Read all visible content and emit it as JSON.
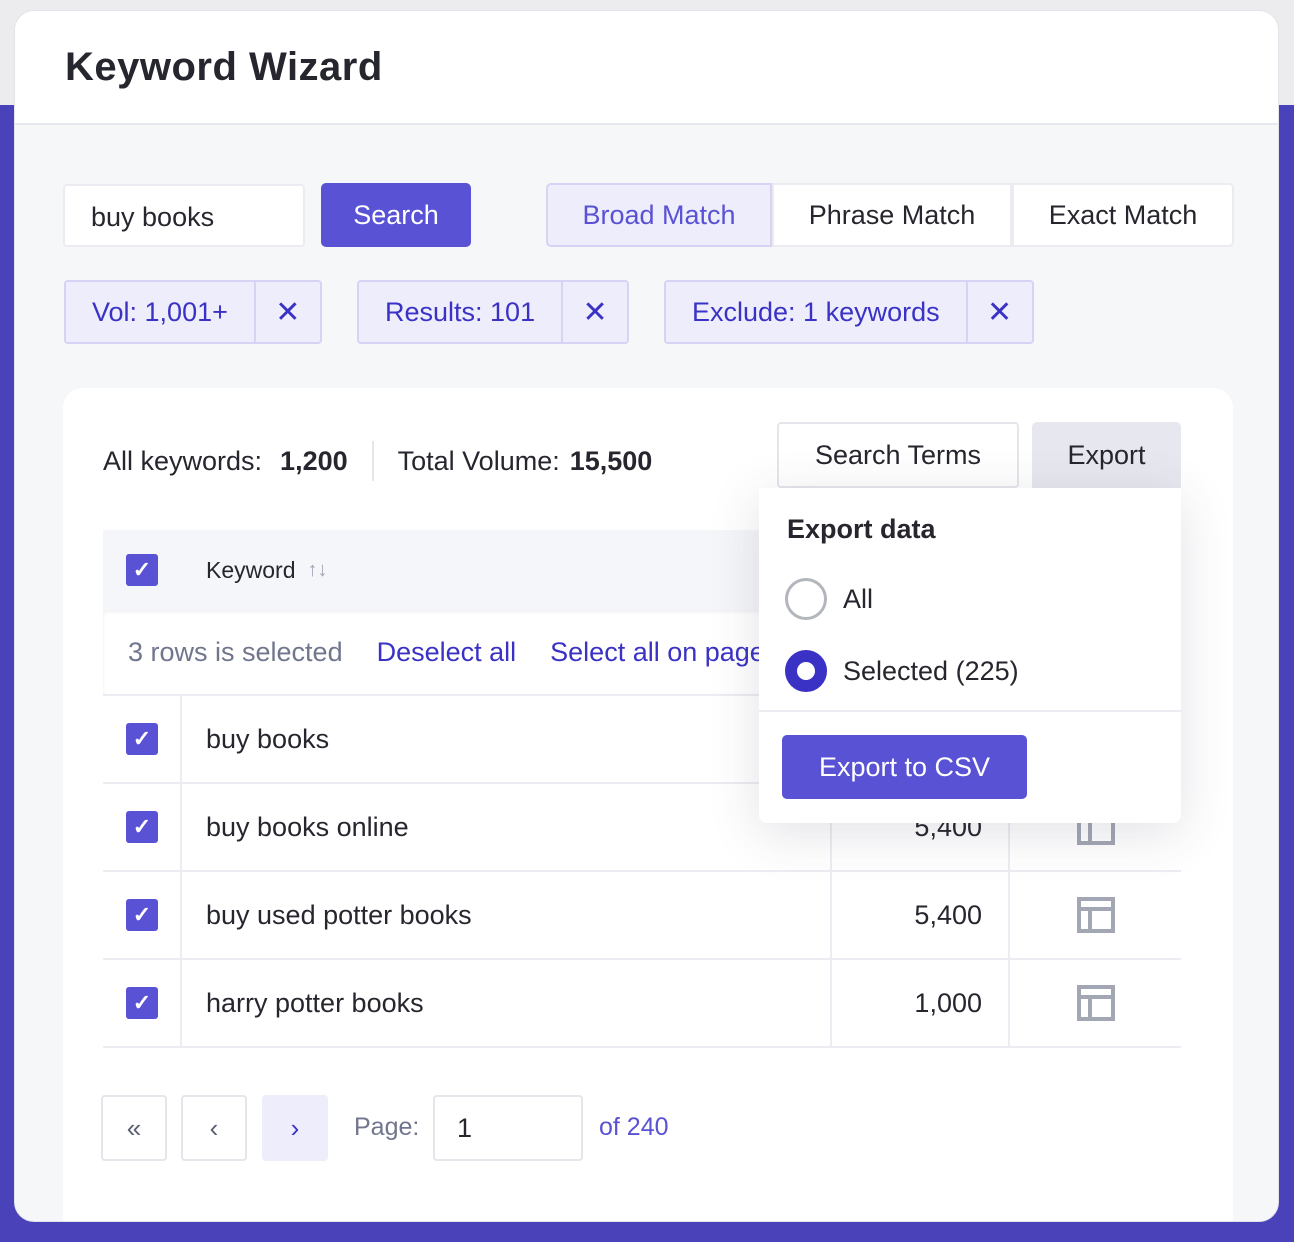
{
  "title": "Keyword Wizard",
  "search": {
    "value": "buy books",
    "button": "Search"
  },
  "match_types": [
    {
      "label": "Broad Match",
      "active": true
    },
    {
      "label": "Phrase Match",
      "active": false
    },
    {
      "label": "Exact Match",
      "active": false
    }
  ],
  "filters": [
    {
      "label": "Vol: 1,001+"
    },
    {
      "label": "Results: 101"
    },
    {
      "label": "Exclude: 1 keywords"
    }
  ],
  "filter_remove": "✕",
  "stats": {
    "all_label": "All keywords:",
    "all_value": "1,200",
    "vol_label": "Total Volume:",
    "vol_value": "15,500"
  },
  "toolbar": {
    "search_terms": "Search Terms",
    "export": "Export"
  },
  "table": {
    "header_keyword": "Keyword",
    "sort_icon": "↑↓",
    "selection_text": "3 rows is selected",
    "deselect_all": "Deselect all",
    "select_all_page": "Select all on page",
    "rows": [
      {
        "keyword": "buy books",
        "volume": "",
        "checked": true
      },
      {
        "keyword": "buy books online",
        "volume": "5,400",
        "checked": true
      },
      {
        "keyword": "buy used potter books",
        "volume": "5,400",
        "checked": true
      },
      {
        "keyword": "harry potter books",
        "volume": "1,000",
        "checked": true
      }
    ]
  },
  "export_menu": {
    "title": "Export data",
    "options": [
      {
        "label": "All",
        "selected": false
      },
      {
        "label": "Selected (225)",
        "selected": true
      }
    ],
    "button": "Export to CSV"
  },
  "pagination": {
    "first": "«",
    "prev": "‹",
    "next": "›",
    "page_label": "Page:",
    "page_value": "1",
    "of_text": "of 240"
  },
  "colors": {
    "accent": "#5952d4",
    "link": "#3a32c4",
    "background_purple": "#4a42b8"
  }
}
